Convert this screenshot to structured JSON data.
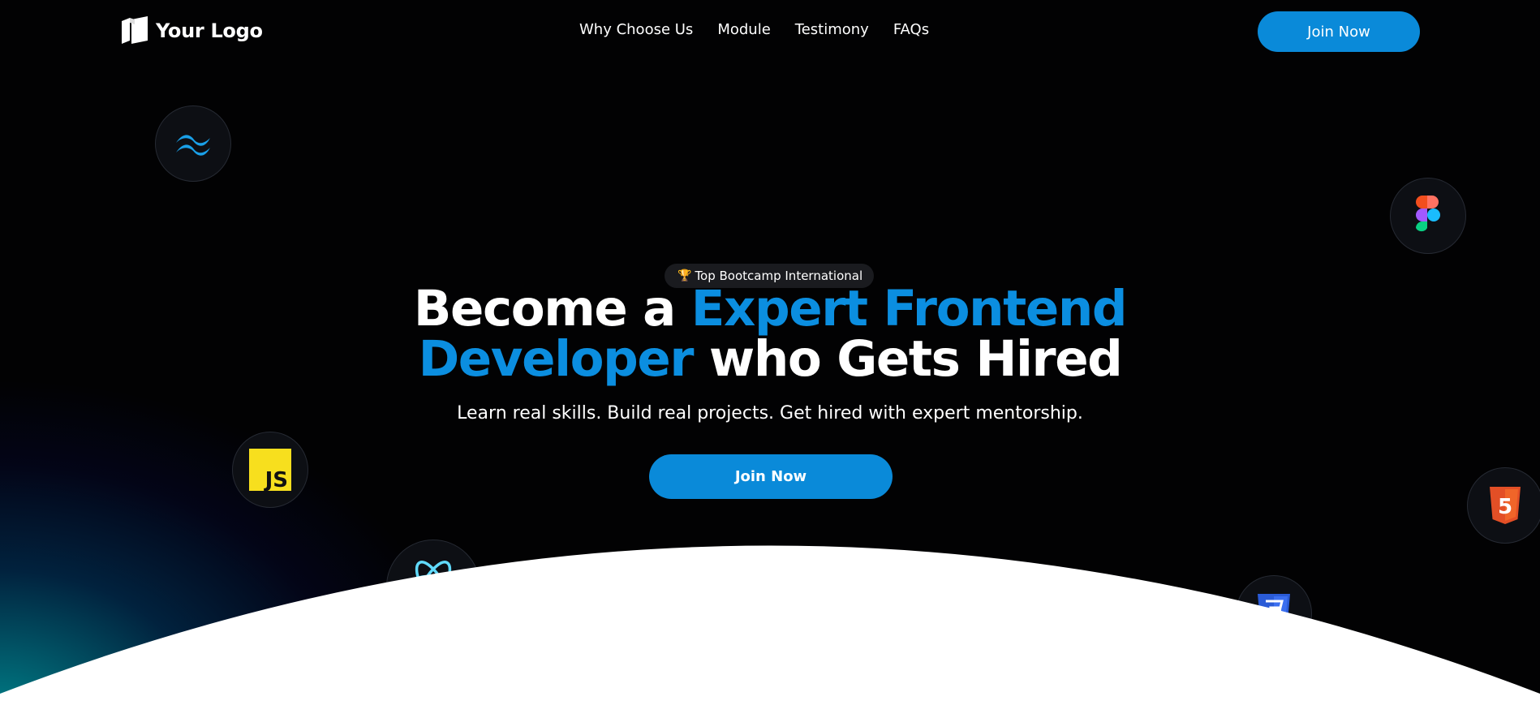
{
  "nav": {
    "logo_text": "Your Logo",
    "links": [
      "Why Choose Us",
      "Module",
      "Testimony",
      "FAQs"
    ],
    "cta_label": "Join Now"
  },
  "hero": {
    "badge_icon": "trophy-icon",
    "badge_text": "Top Bootcamp International",
    "headline": {
      "line1_plain": "Become a ",
      "line1_accent": "Expert Frontend",
      "line2_accent": "Developer",
      "line2_plain": " who Gets Hired"
    },
    "subheadline": "Learn real skills. Build real projects. Get hired with expert mentorship.",
    "cta_label": "Join Now"
  },
  "tech_icons": [
    {
      "name": "tailwind-icon",
      "color": "#1aa0e8"
    },
    {
      "name": "figma-icon",
      "color": "#a259ff"
    },
    {
      "name": "javascript-icon",
      "label": "JS",
      "color": "#f7df1e"
    },
    {
      "name": "html5-icon",
      "label": "5",
      "color": "#e34f26"
    },
    {
      "name": "react-icon",
      "color": "#61dafb"
    },
    {
      "name": "css3-icon",
      "color": "#2a5bd7"
    }
  ],
  "colors": {
    "accent": "#0b8ee0",
    "button": "#0a8ad9",
    "background": "#020203",
    "glow": "#0096a0"
  }
}
